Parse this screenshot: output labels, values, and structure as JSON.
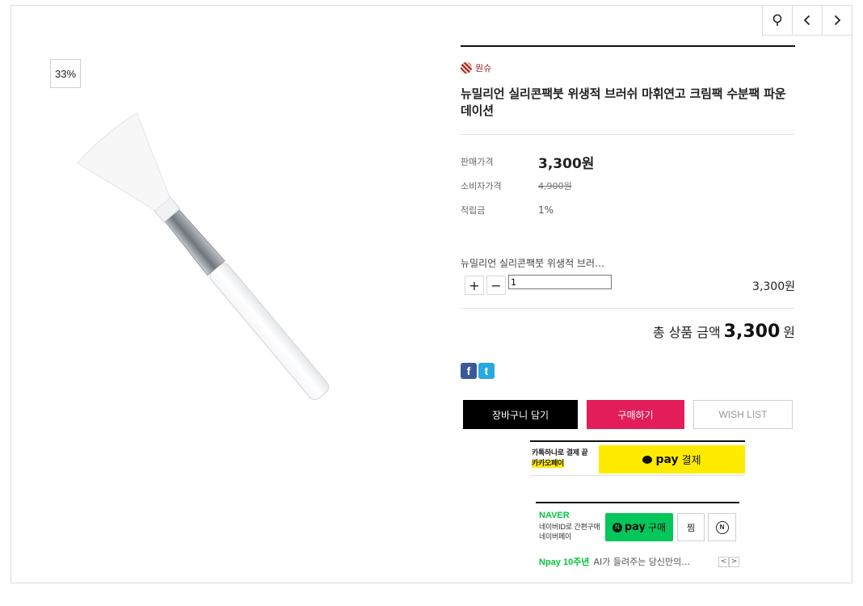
{
  "nav": {
    "buttons": [
      {
        "icon": "search-icon"
      },
      {
        "icon": "chevron-left-icon"
      },
      {
        "icon": "chevron-right-icon"
      }
    ]
  },
  "product": {
    "discount": "33%",
    "brand": "뭔슈",
    "title": "뉴밀리언 실리콘팩붓 위생적 브러쉬 마휘연고 크림팩 수분팩 파운데이션",
    "prices": [
      {
        "label": "판매가격",
        "value": "3,300원"
      },
      {
        "label": "소비자가격",
        "value": "4,900원"
      },
      {
        "label": "적립금",
        "value": "1%"
      }
    ],
    "option": {
      "name": "뉴밀리언 실리콘팩붓 위생적 브러…",
      "plus": "+",
      "minus": "−",
      "quantity": "1",
      "price": "3,300원"
    },
    "total": {
      "label": "총 상품 금액",
      "amount": "3,300",
      "unit": "원"
    }
  },
  "sns": {
    "facebook": "f",
    "twitter": "t"
  },
  "actions": {
    "cart": "장바구니 담기",
    "buy": "구매하기",
    "wish": "WISH LIST"
  },
  "kakao": {
    "line1": "카톡하나로 결제 끝",
    "line2": "카카오페이",
    "pay": "pay",
    "label": "결제"
  },
  "naver": {
    "brand": "NAVER",
    "sub1": "네이버ID로 간편구매",
    "sub2": "네이버페이",
    "pay_n": "N",
    "pay": "pay",
    "buy": "구매",
    "zzim": "찜",
    "talk": "N",
    "footer_highlight": "Npay 10주년",
    "footer_text": "AI가 들려주는 당신만의…",
    "prev": "<",
    "next": ">"
  }
}
